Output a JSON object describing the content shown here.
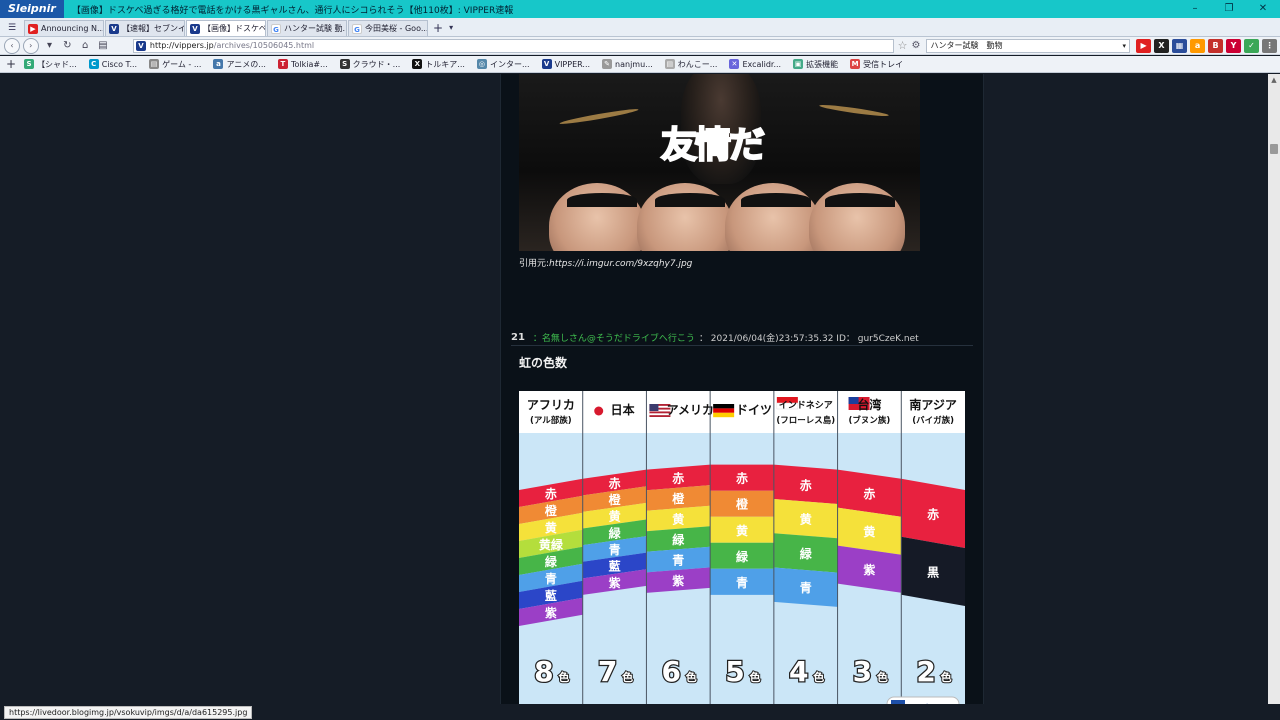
{
  "window": {
    "app_name": "Sleipnir",
    "title": "【画像】ドスケベ過ぎる格好で電話をかける黒ギャルさん、通行人にシコられそう【他110枚】: VIPPER速報",
    "min": "–",
    "max": "❐",
    "close": "✕"
  },
  "tabs": [
    {
      "label": "Announcing N...",
      "fav": "yt",
      "fav_text": "▶",
      "active": false
    },
    {
      "label": "【速報】セブンイレ...",
      "fav": "v",
      "fav_text": "V",
      "active": false
    },
    {
      "label": "【画像】ドスケベ過...",
      "fav": "v",
      "fav_text": "V",
      "active": true
    },
    {
      "label": "ハンター試験 動...",
      "fav": "g",
      "fav_text": "G",
      "active": false
    },
    {
      "label": "今田美桜 - Goo...",
      "fav": "g",
      "fav_text": "G",
      "active": false
    }
  ],
  "tabbar": {
    "add": "+",
    "dropdown": "▾",
    "menu": "☰"
  },
  "address": {
    "back": "‹",
    "forward": "›",
    "dropdown": "▾",
    "reload": "↻",
    "home": "⌂",
    "reader": "▤",
    "fav_text": "V",
    "url_host": "http://vippers.jp",
    "url_rest": "/archives/10506045.html",
    "star": "☆",
    "gear": "⚙",
    "search_value": "ハンター試験　動物",
    "search_dropdown": "▾"
  },
  "extensions": [
    {
      "text": "▶",
      "color": "#e02020"
    },
    {
      "text": "X",
      "color": "#222222"
    },
    {
      "text": "▦",
      "color": "#2b4d9a"
    },
    {
      "text": "a",
      "color": "#ff9900"
    },
    {
      "text": "B",
      "color": "#c4302b"
    },
    {
      "text": "Y",
      "color": "#cc0033"
    },
    {
      "text": "✓",
      "color": "#3aa757"
    },
    {
      "text": "⋮",
      "color": "#777777"
    }
  ],
  "bookmarks": {
    "add": "+",
    "items": [
      {
        "label": "【シャド...",
        "icon": "S",
        "color": "#3a7"
      },
      {
        "label": "Cisco T...",
        "icon": "C",
        "color": "#09c"
      },
      {
        "label": "ゲーム - ...",
        "icon": "▤",
        "color": "#888"
      },
      {
        "label": "アニメの...",
        "icon": "a",
        "color": "#47a"
      },
      {
        "label": "Tolkia#...",
        "icon": "T",
        "color": "#c23"
      },
      {
        "label": "クラウド・...",
        "icon": "S",
        "color": "#333"
      },
      {
        "label": "トルキア...",
        "icon": "X",
        "color": "#111"
      },
      {
        "label": "インター...",
        "icon": "◎",
        "color": "#58a"
      },
      {
        "label": "VIPPER...",
        "icon": "V",
        "color": "#1a3a8c"
      },
      {
        "label": "nanjmu...",
        "icon": "✎",
        "color": "#999"
      },
      {
        "label": "わんこー...",
        "icon": "▤",
        "color": "#aaa"
      },
      {
        "label": "Excalidr...",
        "icon": "✕",
        "color": "#6965db"
      },
      {
        "label": "拡張機能",
        "icon": "▣",
        "color": "#4a8"
      },
      {
        "label": "受信トレイ",
        "icon": "M",
        "color": "#d44"
      }
    ]
  },
  "post_prev": {
    "image_caption_main": "友情",
    "image_caption_accent": "だ",
    "source_label": "引用元:",
    "source_url": "https://i.imgur.com/9xzqhy7.jpg"
  },
  "post": {
    "number": "21",
    "name": "：名無しさん@そうだドライブへ行こう",
    "meta": "： 2021/06/04(金)23:57:35.32 ID： gur5CzeK.net",
    "body": "虹の色数"
  },
  "chart": {
    "columns": [
      {
        "name": "アフリカ",
        "sub": "(アル部族)",
        "flag": "none",
        "colors": [
          "赤",
          "橙",
          "黄",
          "黄緑",
          "緑",
          "青",
          "藍",
          "紫"
        ],
        "count": "8"
      },
      {
        "name": "日本",
        "sub": "",
        "flag": "jp",
        "colors": [
          "赤",
          "橙",
          "黄",
          "緑",
          "青",
          "藍",
          "紫"
        ],
        "count": "7"
      },
      {
        "name": "アメリカ",
        "sub": "",
        "flag": "us",
        "colors": [
          "赤",
          "橙",
          "黄",
          "緑",
          "青",
          "紫"
        ],
        "count": "6"
      },
      {
        "name": "ドイツ",
        "sub": "",
        "flag": "de",
        "colors": [
          "赤",
          "橙",
          "黄",
          "緑",
          "青"
        ],
        "count": "5"
      },
      {
        "name": "インドネシア",
        "sub": "(フローレス島)",
        "flag": "id",
        "colors": [
          "赤",
          "黄",
          "緑",
          "青"
        ],
        "count": "4"
      },
      {
        "name": "台湾",
        "sub": "(ブヌン族)",
        "flag": "tw",
        "colors": [
          "赤",
          "黄",
          "紫"
        ],
        "count": "3"
      },
      {
        "name": "南アジア",
        "sub": "(バイガ族)",
        "flag": "none",
        "colors": [
          "赤",
          "黒"
        ],
        "count": "2"
      }
    ],
    "count_suffix": "色",
    "swatches": {
      "赤": "#e8213f",
      "橙": "#f08a34",
      "黄": "#f5e13a",
      "黄緑": "#b4de3c",
      "緑": "#47b548",
      "青": "#4fa0e8",
      "藍": "#2b46c8",
      "紫": "#9b3fc6",
      "黒": "#151a26"
    },
    "logo": "weathernews"
  },
  "status": {
    "url": "https://livedoor.blogimg.jp/vsokuvip/imgs/d/a/da615295.jpg"
  }
}
